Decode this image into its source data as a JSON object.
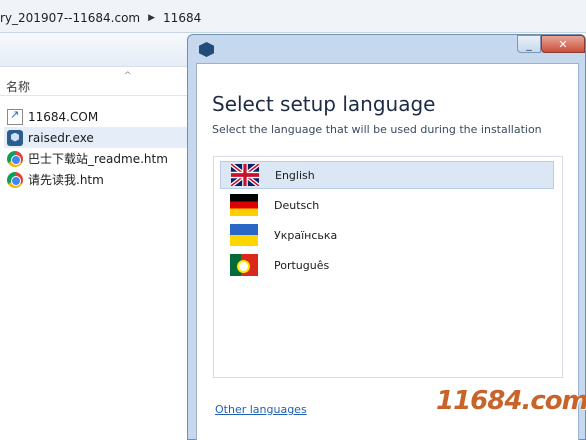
{
  "explorer": {
    "breadcrumb": [
      "ry_201907--11684.com",
      "11684"
    ],
    "column_name": "名称",
    "files": [
      {
        "name": "11684.COM",
        "icon": "shortcut-icon"
      },
      {
        "name": "raisedr.exe",
        "icon": "app-icon",
        "selected": true
      },
      {
        "name": "巴士下载站_readme.htm",
        "icon": "chrome-icon"
      },
      {
        "name": "请先读我.htm",
        "icon": "chrome-icon"
      }
    ]
  },
  "dialog": {
    "heading": "Select setup language",
    "subheading": "Select the language that will be used during the installation",
    "languages": [
      {
        "label": "English",
        "flag": "uk-flag-icon",
        "selected": true
      },
      {
        "label": "Deutsch",
        "flag": "germany-flag-icon"
      },
      {
        "label": "Українська",
        "flag": "ukraine-flag-icon"
      },
      {
        "label": "Português",
        "flag": "portugal-flag-icon"
      }
    ],
    "other_languages_link": "Other languages",
    "minimize_glyph": "_",
    "close_glyph": "✕"
  },
  "watermark": "11684.com",
  "colors": {
    "accent": "#2160b4",
    "selection": "#dce7f5",
    "watermark": "#c8632a"
  }
}
